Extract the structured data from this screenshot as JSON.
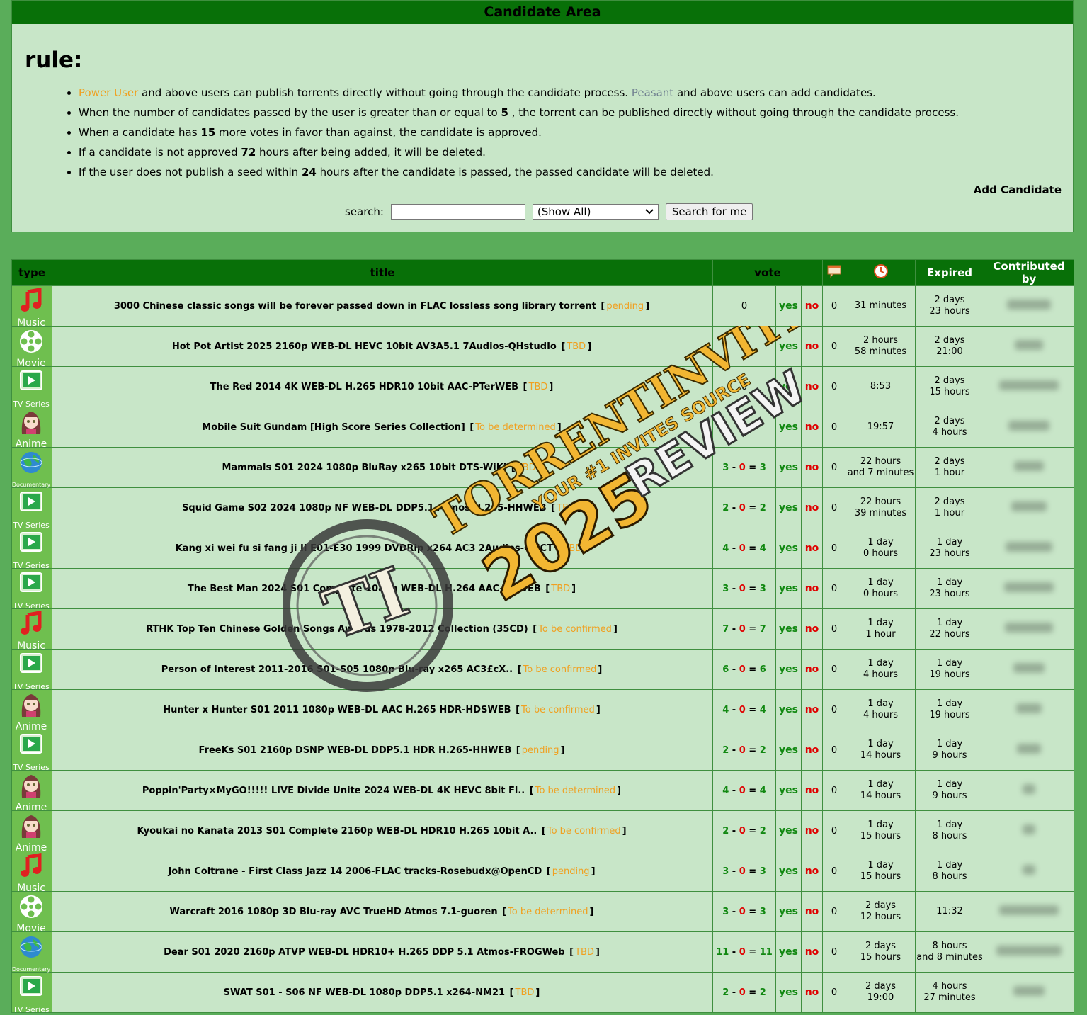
{
  "panel": {
    "header": "Candidate Area",
    "rule_title": "rule:",
    "rules": {
      "r1": {
        "power_user": "Power User",
        "mid": " and above users can publish torrents directly without going through the candidate process. ",
        "peasant": "Peasant",
        "end": " and above users can add candidates."
      },
      "r2": {
        "pre": "When the number of candidates passed by the user is greater than or equal to ",
        "num": "5",
        "post": " , the torrent can be published directly without going through the candidate process."
      },
      "r3": {
        "pre": "When a candidate has ",
        "num": "15",
        "post": " more votes in favor than against, the candidate is approved."
      },
      "r4": {
        "pre": "If a candidate is not approved ",
        "num": "72",
        "post": " hours after being added, it will be deleted."
      },
      "r5": {
        "pre": "If the user does not publish a seed within ",
        "num": "24",
        "post": " hours after the candidate is passed, the passed candidate will be deleted."
      }
    },
    "add_candidate": "Add Candidate",
    "search": {
      "label": "search:",
      "value": "",
      "select_value": "(Show All)",
      "button": "Search for me"
    }
  },
  "table": {
    "headers": {
      "type": "type",
      "title": "title",
      "vote": "vote",
      "expired": "Expired",
      "contributed": "Contributed by"
    },
    "header_icons": [
      "comments-icon",
      "clock-icon"
    ],
    "yes_label": "yes",
    "no_label": "no",
    "rows": [
      {
        "type": "Music",
        "title": "3000 Chinese classic songs will be forever passed down in FLAC lossless song library torrent",
        "status": "pending",
        "vote": {
          "plain": "0"
        },
        "comments": "0",
        "time1": "31 minutes",
        "time2": "",
        "exp1": "2 days",
        "exp2": "23 hours"
      },
      {
        "type": "Movie",
        "title": "Hot Pot Artist 2025 2160p WEB-DL HEVC 10bit AV3A5.1 7Audios-QHstudIo",
        "status": "TBD",
        "vote": {
          "plain": "0"
        },
        "comments": "0",
        "time1": "2 hours",
        "time2": "58 minutes",
        "exp1": "2 days",
        "exp2": "21:00"
      },
      {
        "type": "TV Series",
        "title": "The Red 2014 4K WEB-DL H.265 HDR10 10bit AAC-PTerWEB",
        "status": "TBD",
        "vote": {
          "plain": "0"
        },
        "comments": "0",
        "time1": "8:53",
        "time2": "",
        "exp1": "2 days",
        "exp2": "15 hours"
      },
      {
        "type": "Anime",
        "title": "Mobile Suit Gundam [High Score Series Collection]",
        "status": "To be determined",
        "vote": {
          "plain": ""
        },
        "comments": "0",
        "time1": "19:57",
        "time2": "",
        "exp1": "2 days",
        "exp2": "4 hours"
      },
      {
        "type": "Documentary",
        "title": "Mammals S01 2024 1080p BluRay x265 10bit DTS-WiKi",
        "status": "TBD",
        "vote": {
          "a": "3",
          "b": "0",
          "c": "3"
        },
        "comments": "0",
        "time1": "22 hours",
        "time2": "and 7 minutes",
        "exp1": "2 days",
        "exp2": "1 hour"
      },
      {
        "type": "TV Series",
        "title": "Squid Game S02 2024 1080p NF WEB-DL DDP5.1 Atmos H.265-HHWEB",
        "status": "TBD",
        "vote": {
          "a": "2",
          "b": "0",
          "c": "2"
        },
        "comments": "0",
        "time1": "22 hours",
        "time2": "39 minutes",
        "exp1": "2 days",
        "exp2": "1 hour"
      },
      {
        "type": "TV Series",
        "title": "Kang xi wei fu si fang ji II E01-E30 1999 DVDRip x264 AC3 2Audios-CMCT",
        "status": "TBD",
        "vote": {
          "a": "4",
          "b": "0",
          "c": "4"
        },
        "comments": "0",
        "time1": "1 day",
        "time2": "0 hours",
        "exp1": "1 day",
        "exp2": "23 hours"
      },
      {
        "type": "TV Series",
        "title": "The Best Man 2024 S01 Complete 1080p WEB-DL H.264 AAC-UBWEB",
        "status": "TBD",
        "vote": {
          "a": "3",
          "b": "0",
          "c": "3"
        },
        "comments": "0",
        "time1": "1 day",
        "time2": "0 hours",
        "exp1": "1 day",
        "exp2": "23 hours"
      },
      {
        "type": "Music",
        "title": "RTHK Top Ten Chinese Golden Songs Awards 1978-2012 Collection (35CD)",
        "status": "To be confirmed",
        "vote": {
          "a": "7",
          "b": "0",
          "c": "7"
        },
        "comments": "0",
        "time1": "1 day",
        "time2": "1 hour",
        "exp1": "1 day",
        "exp2": "22 hours"
      },
      {
        "type": "TV Series",
        "title": "Person of Interest 2011-2016 S01-S05 1080p Blu-ray x265 AC3£cX..",
        "status": "To be confirmed",
        "vote": {
          "a": "6",
          "b": "0",
          "c": "6"
        },
        "comments": "0",
        "time1": "1 day",
        "time2": "4 hours",
        "exp1": "1 day",
        "exp2": "19 hours"
      },
      {
        "type": "Anime",
        "title": "Hunter x Hunter S01 2011 1080p WEB-DL AAC H.265 HDR-HDSWEB",
        "status": "To be confirmed",
        "vote": {
          "a": "4",
          "b": "0",
          "c": "4"
        },
        "comments": "0",
        "time1": "1 day",
        "time2": "4 hours",
        "exp1": "1 day",
        "exp2": "19 hours"
      },
      {
        "type": "TV Series",
        "title": "FreeKs S01 2160p DSNP WEB-DL DDP5.1 HDR H.265-HHWEB",
        "status": "pending",
        "vote": {
          "a": "2",
          "b": "0",
          "c": "2"
        },
        "comments": "0",
        "time1": "1 day",
        "time2": "14 hours",
        "exp1": "1 day",
        "exp2": "9 hours"
      },
      {
        "type": "Anime",
        "title": "Poppin'Party×MyGO!!!!! LIVE Divide Unite 2024 WEB-DL 4K HEVC 8bit Fl..",
        "status": "To be determined",
        "vote": {
          "a": "4",
          "b": "0",
          "c": "4"
        },
        "comments": "0",
        "time1": "1 day",
        "time2": "14 hours",
        "exp1": "1 day",
        "exp2": "9 hours"
      },
      {
        "type": "Anime",
        "title": "Kyoukai no Kanata 2013 S01 Complete 2160p WEB-DL HDR10 H.265 10bit A..",
        "status": "To be confirmed",
        "vote": {
          "a": "2",
          "b": "0",
          "c": "2"
        },
        "comments": "0",
        "time1": "1 day",
        "time2": "15 hours",
        "exp1": "1 day",
        "exp2": "8 hours"
      },
      {
        "type": "Music",
        "title": "John Coltrane - First Class Jazz 14 2006-FLAC tracks-Rosebudx@OpenCD",
        "status": "pending",
        "vote": {
          "a": "3",
          "b": "0",
          "c": "3"
        },
        "comments": "0",
        "time1": "1 day",
        "time2": "15 hours",
        "exp1": "1 day",
        "exp2": "8 hours"
      },
      {
        "type": "Movie",
        "title": "Warcraft 2016 1080p 3D Blu-ray AVC TrueHD Atmos 7.1-guoren",
        "status": "To be determined",
        "vote": {
          "a": "3",
          "b": "0",
          "c": "3"
        },
        "comments": "0",
        "time1": "2 days",
        "time2": "12 hours",
        "exp1": "11:32",
        "exp2": ""
      },
      {
        "type": "Documentary",
        "title": "Dear S01 2020 2160p ATVP WEB-DL HDR10+ H.265 DDP 5.1 Atmos-FROGWeb",
        "status": "TBD",
        "vote": {
          "a": "11",
          "b": "0",
          "c": "11"
        },
        "comments": "0",
        "time1": "2 days",
        "time2": "15 hours",
        "exp1": "8 hours",
        "exp2": "and 8 minutes"
      },
      {
        "type": "TV Series",
        "title": "SWAT S01 - S06 NF WEB-DL 1080p DDP5.1 x264-NM21",
        "status": "TBD",
        "vote": {
          "a": "2",
          "b": "0",
          "c": "2"
        },
        "comments": "0",
        "time1": "2 days",
        "time2": "19:00",
        "exp1": "4 hours",
        "exp2": "27 minutes"
      }
    ]
  },
  "watermark": {
    "line1": "TORRENTINVITES.ORG",
    "line2": "YOUR #1 INVITES SOURCE",
    "year": "2025",
    "review": "REVIEW",
    "logo": "TI"
  },
  "colors": {
    "header_green": "#087008",
    "panel_bg": "#c8e6c8",
    "page_bg": "#5aad5a",
    "status_orange": "#f0a020",
    "yes_green": "#118811",
    "no_red": "#e00000"
  }
}
